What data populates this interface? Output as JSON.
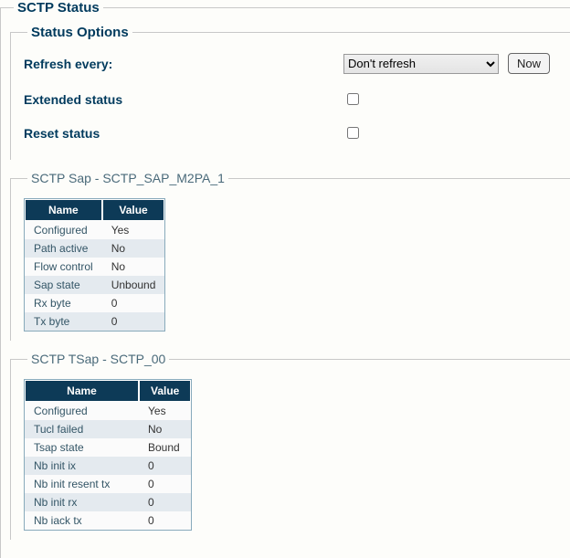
{
  "title": "SCTP Status",
  "options": {
    "legend": "Status Options",
    "refresh_label": "Refresh every:",
    "refresh_selected": "Don't refresh",
    "now_button": "Now",
    "extended_label": "Extended status",
    "extended_checked": false,
    "reset_label": "Reset status",
    "reset_checked": false
  },
  "sap": {
    "legend": "SCTP Sap - SCTP_SAP_M2PA_1",
    "headers": {
      "name": "Name",
      "value": "Value"
    },
    "rows": [
      {
        "name": "Configured",
        "value": "Yes"
      },
      {
        "name": "Path active",
        "value": "No"
      },
      {
        "name": "Flow control",
        "value": "No"
      },
      {
        "name": "Sap state",
        "value": "Unbound"
      },
      {
        "name": "Rx byte",
        "value": "0"
      },
      {
        "name": "Tx byte",
        "value": "0"
      }
    ]
  },
  "tsap": {
    "legend": "SCTP TSap - SCTP_00",
    "headers": {
      "name": "Name",
      "value": "Value"
    },
    "rows": [
      {
        "name": "Configured",
        "value": "Yes"
      },
      {
        "name": "Tucl failed",
        "value": "No"
      },
      {
        "name": "Tsap state",
        "value": "Bound"
      },
      {
        "name": "Nb init ix",
        "value": "0"
      },
      {
        "name": "Nb init resent tx",
        "value": "0"
      },
      {
        "name": "Nb init rx",
        "value": "0"
      },
      {
        "name": "Nb iack tx",
        "value": "0"
      }
    ]
  }
}
